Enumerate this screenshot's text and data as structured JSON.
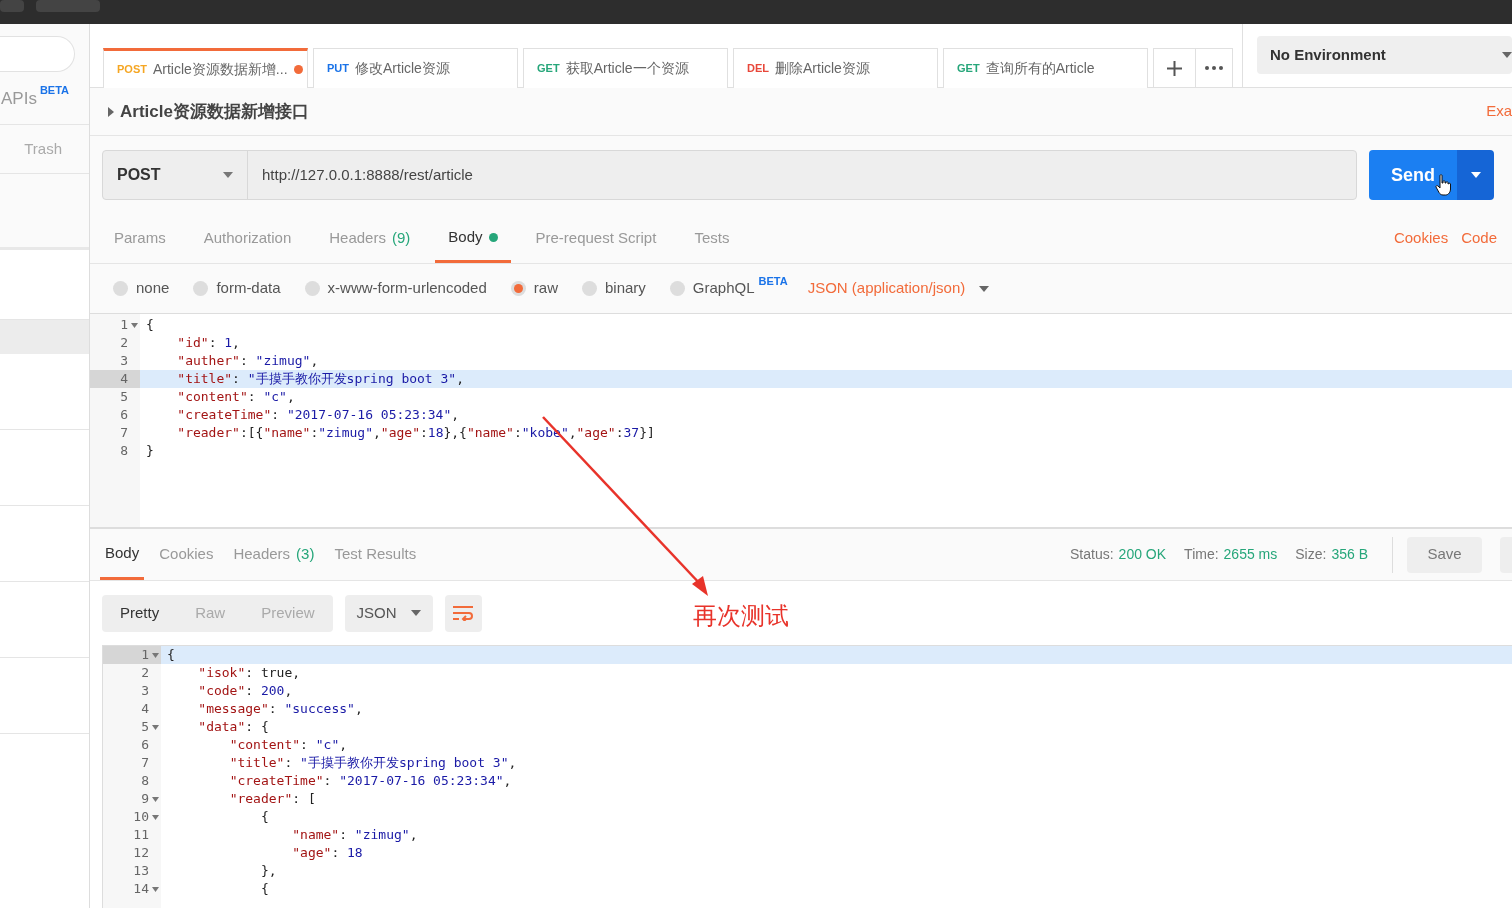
{
  "sidebar": {
    "apis_label": "APIs",
    "apis_badge": "BETA",
    "trash": "Trash"
  },
  "tabs": [
    {
      "method": "POST",
      "title": "Article资源数据新增...",
      "selected": true,
      "unsaved": true
    },
    {
      "method": "PUT",
      "title": "修改Article资源",
      "selected": false,
      "unsaved": false
    },
    {
      "method": "GET",
      "title": "获取Article一个资源",
      "selected": false,
      "unsaved": false
    },
    {
      "method": "DEL",
      "title": "删除Article资源",
      "selected": false,
      "unsaved": false
    },
    {
      "method": "GET",
      "title": "查询所有的Article",
      "selected": false,
      "unsaved": false
    }
  ],
  "environment": "No Environment",
  "request_title": "Article资源数据新增接口",
  "examples_link": "Exa",
  "method": "POST",
  "url": "http://127.0.0.1:8888/rest/article",
  "send": "Send",
  "request_tabs": [
    {
      "label": "Params",
      "selected": false
    },
    {
      "label": "Authorization",
      "selected": false
    },
    {
      "label": "Headers",
      "count": "(9)",
      "selected": false
    },
    {
      "label": "Body",
      "selected": true,
      "dot": true
    },
    {
      "label": "Pre-request Script",
      "selected": false
    },
    {
      "label": "Tests",
      "selected": false
    }
  ],
  "cookies_link": "Cookies",
  "code_link": "Code",
  "body_modes": [
    {
      "label": "none",
      "selected": false
    },
    {
      "label": "form-data",
      "selected": false
    },
    {
      "label": "x-www-form-urlencoded",
      "selected": false
    },
    {
      "label": "raw",
      "selected": true
    },
    {
      "label": "binary",
      "selected": false
    },
    {
      "label": "GraphQL",
      "badge": "BETA",
      "selected": false
    }
  ],
  "content_type": "JSON (application/json)",
  "request_body": [
    {
      "number": "1",
      "text": "{",
      "fold": true,
      "active": false
    },
    {
      "number": "2",
      "text": "    \"id\": 1,",
      "fold": false,
      "active": false
    },
    {
      "number": "3",
      "text": "    \"auther\": \"zimug\",",
      "fold": false,
      "active": false
    },
    {
      "number": "4",
      "text": "    \"title\": \"手摸手教你开发spring boot 3\",",
      "fold": false,
      "active": true
    },
    {
      "number": "5",
      "text": "    \"content\": \"c\",",
      "fold": false,
      "active": false
    },
    {
      "number": "6",
      "text": "    \"createTime\": \"2017-07-16 05:23:34\",",
      "fold": false,
      "active": false
    },
    {
      "number": "7",
      "text": "    \"reader\":[{\"name\":\"zimug\",\"age\":18},{\"name\":\"kobe\",\"age\":37}]",
      "fold": false,
      "active": false
    },
    {
      "number": "8",
      "text": "}",
      "fold": false,
      "active": false
    }
  ],
  "response_tabs": [
    {
      "label": "Body",
      "selected": true
    },
    {
      "label": "Cookies",
      "selected": false
    },
    {
      "label": "Headers",
      "count": "(3)",
      "selected": false
    },
    {
      "label": "Test Results",
      "selected": false
    }
  ],
  "status": {
    "label": "Status:",
    "value": "200 OK"
  },
  "time": {
    "label": "Time:",
    "value": "2655 ms"
  },
  "size": {
    "label": "Size:",
    "value": "356 B"
  },
  "save": "Save",
  "view_modes": [
    {
      "label": "Pretty",
      "selected": true
    },
    {
      "label": "Raw",
      "selected": false
    },
    {
      "label": "Preview",
      "selected": false
    }
  ],
  "format": "JSON",
  "response_body": [
    {
      "number": "1",
      "text": "{",
      "fold": true,
      "active": true
    },
    {
      "number": "2",
      "text": "    \"isok\": true,",
      "fold": false,
      "active": false
    },
    {
      "number": "3",
      "text": "    \"code\": 200,",
      "fold": false,
      "active": false
    },
    {
      "number": "4",
      "text": "    \"message\": \"success\",",
      "fold": false,
      "active": false
    },
    {
      "number": "5",
      "text": "    \"data\": {",
      "fold": true,
      "active": false
    },
    {
      "number": "6",
      "text": "        \"content\": \"c\",",
      "fold": false,
      "active": false
    },
    {
      "number": "7",
      "text": "        \"title\": \"手摸手教你开发spring boot 3\",",
      "fold": false,
      "active": false
    },
    {
      "number": "8",
      "text": "        \"createTime\": \"2017-07-16 05:23:34\",",
      "fold": false,
      "active": false
    },
    {
      "number": "9",
      "text": "        \"reader\": [",
      "fold": true,
      "active": false
    },
    {
      "number": "10",
      "text": "            {",
      "fold": true,
      "active": false
    },
    {
      "number": "11",
      "text": "                \"name\": \"zimug\",",
      "fold": false,
      "active": false
    },
    {
      "number": "12",
      "text": "                \"age\": 18",
      "fold": false,
      "active": false
    },
    {
      "number": "13",
      "text": "            },",
      "fold": false,
      "active": false
    },
    {
      "number": "14",
      "text": "            {",
      "fold": true,
      "active": false
    }
  ],
  "annotation": "再次测试"
}
